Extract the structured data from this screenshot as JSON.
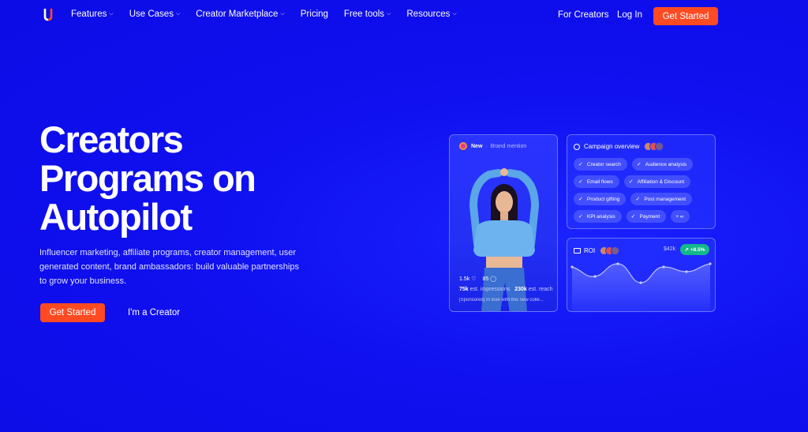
{
  "nav": {
    "items": [
      {
        "label": "Features",
        "has_dropdown": true
      },
      {
        "label": "Use Cases",
        "has_dropdown": true
      },
      {
        "label": "Creator Marketplace",
        "has_dropdown": true
      },
      {
        "label": "Pricing",
        "has_dropdown": false
      },
      {
        "label": "Free tools",
        "has_dropdown": true
      },
      {
        "label": "Resources",
        "has_dropdown": true
      }
    ],
    "for_creators": "For Creators",
    "login": "Log In",
    "cta": "Get Started"
  },
  "hero": {
    "title_lines": [
      "Creators",
      "Programs on",
      "Autopilot"
    ],
    "subtitle": "Influencer marketing, affiliate programs, creator management, user generated content, brand ambassadors: build valuable partnerships to grow your business.",
    "cta": "Get Started",
    "secondary": "I'm a Creator"
  },
  "post_card": {
    "badge": "New",
    "type": "Brand mention",
    "likes": "1.5k",
    "comments": "85",
    "impressions_value": "75k",
    "impressions_label": "est. impressions",
    "reach_value": "230k",
    "reach_label": "est. reach",
    "caption": "[Sponsored] In love with this new colle..."
  },
  "overview_card": {
    "title": "Campaign overview",
    "tags": [
      "Creator search",
      "Audience analysis",
      "Email flows",
      "Affiliation & Discount",
      "Product gifting",
      "Post management",
      "KPI analysis",
      "Payment",
      "+ ∞"
    ]
  },
  "roi_card": {
    "title": "ROI",
    "value": "$42k",
    "change": "+8.5%"
  },
  "colors": {
    "background": "#1010f0",
    "accent": "#ff4a22",
    "positive": "#14b88a"
  }
}
